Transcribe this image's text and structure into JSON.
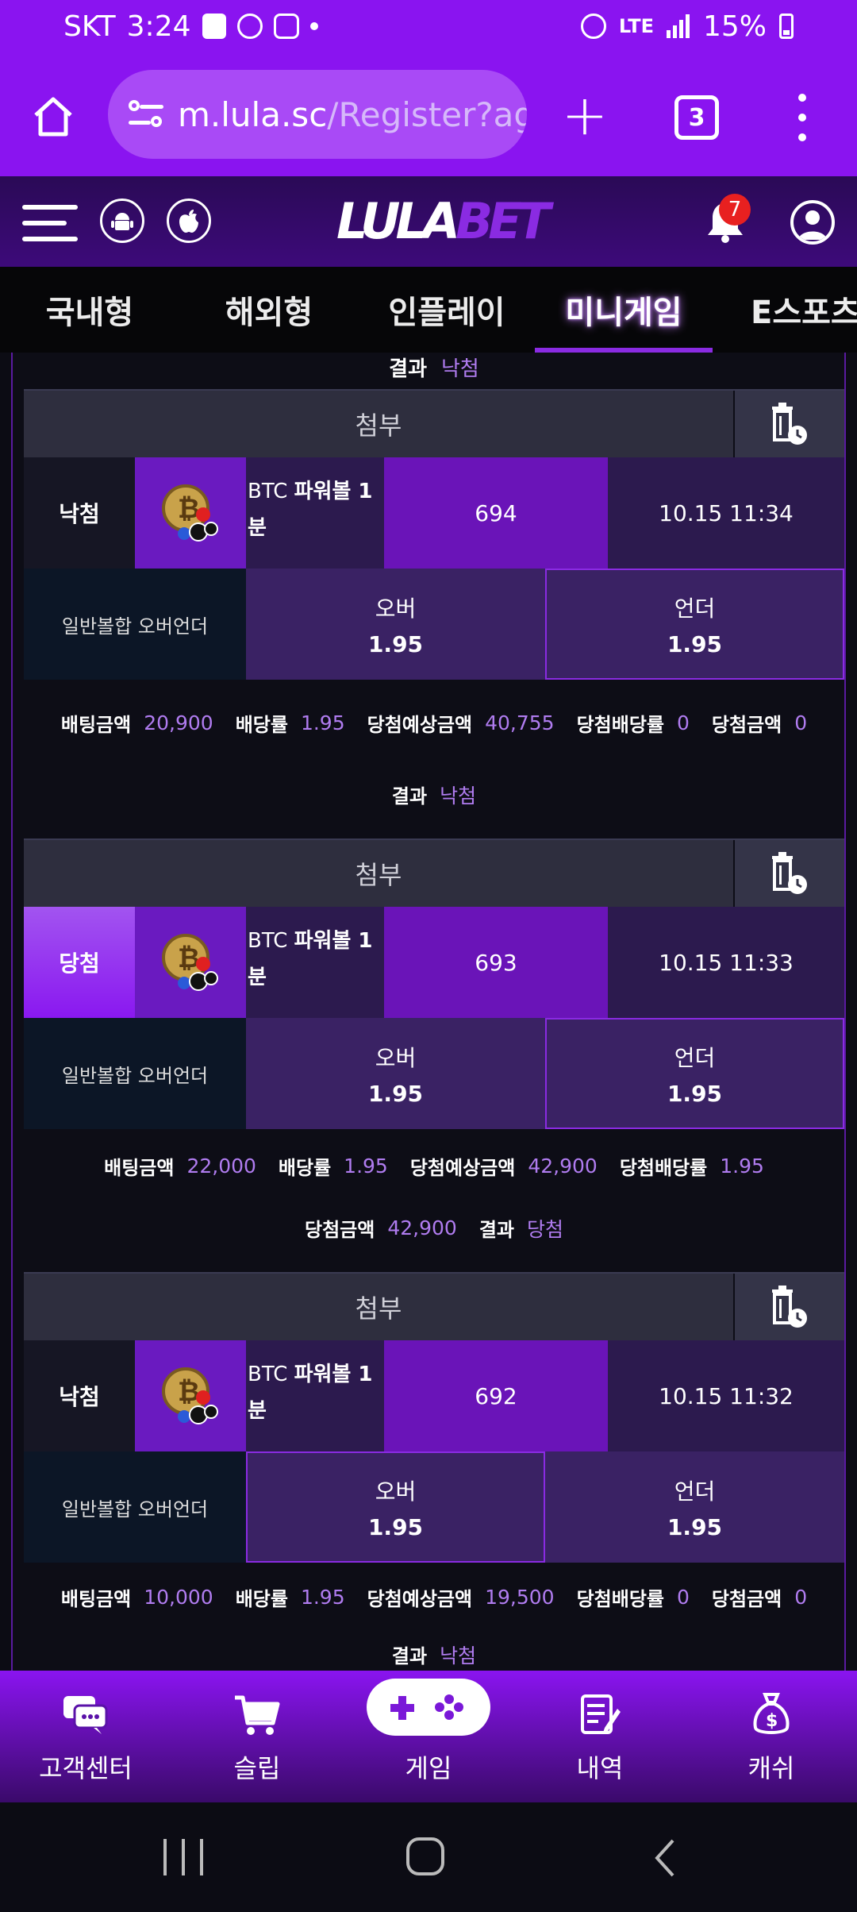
{
  "status_bar": {
    "carrier": "SKT",
    "time": "3:24",
    "network": "LTE",
    "battery": "15%"
  },
  "browser": {
    "url_host": "m.lula.sc",
    "url_path": "/Register?ag",
    "tab_count": "3"
  },
  "site": {
    "logo_part1": "LULA",
    "logo_part2": "BET",
    "notification_count": "7"
  },
  "category_tabs": [
    {
      "label": "국내형"
    },
    {
      "label": "해외형"
    },
    {
      "label": "인플레이"
    },
    {
      "label": "미니게임",
      "active": true
    },
    {
      "label": "E스포츠"
    }
  ],
  "top_result": {
    "label": "결과",
    "value": "낙첨"
  },
  "bets": [
    {
      "attach_label": "첨부",
      "status": "낙첨",
      "game_name": "BTC 파워볼 1분",
      "round": "694",
      "time": "10.15 11:34",
      "market": "일반볼합 오버언더",
      "option1_name": "오버",
      "option1_odds": "1.95",
      "option2_name": "언더",
      "option2_odds": "1.95",
      "bet_amount_label": "배팅금액",
      "bet_amount": "20,900",
      "odds_label": "배당률",
      "odds": "1.95",
      "expected_label": "당첨예상금액",
      "expected": "40,755",
      "win_odds_label": "당첨배당률",
      "win_odds": "0",
      "win_amount_label": "당첨금액",
      "win_amount": "0",
      "result_label": "결과",
      "result": "낙첨"
    },
    {
      "attach_label": "첨부",
      "status": "당첨",
      "game_name": "BTC 파워볼 1분",
      "round": "693",
      "time": "10.15 11:33",
      "market": "일반볼합 오버언더",
      "option1_name": "오버",
      "option1_odds": "1.95",
      "option2_name": "언더",
      "option2_odds": "1.95",
      "bet_amount_label": "배팅금액",
      "bet_amount": "22,000",
      "odds_label": "배당률",
      "odds": "1.95",
      "expected_label": "당첨예상금액",
      "expected": "42,900",
      "win_odds_label": "당첨배당률",
      "win_odds": "1.95",
      "win_amount_label": "당첨금액",
      "win_amount": "42,900",
      "result_label": "결과",
      "result": "당첨"
    },
    {
      "attach_label": "첨부",
      "status": "낙첨",
      "game_name": "BTC 파워볼 1분",
      "round": "692",
      "time": "10.15 11:32",
      "market": "일반볼합 오버언더",
      "option1_name": "오버",
      "option1_odds": "1.95",
      "option2_name": "언더",
      "option2_odds": "1.95",
      "bet_amount_label": "배팅금액",
      "bet_amount": "10,000",
      "odds_label": "배당률",
      "odds": "1.95",
      "expected_label": "당첨예상금액",
      "expected": "19,500",
      "win_odds_label": "당첨배당률",
      "win_odds": "0",
      "win_amount_label": "당첨금액",
      "win_amount": "0",
      "result_label": "결과",
      "result": "낙첨"
    }
  ],
  "bottom_nav": [
    {
      "label": "고객센터",
      "icon": "chat-icon"
    },
    {
      "label": "슬립",
      "icon": "cart-icon"
    },
    {
      "label": "게임",
      "icon": "gamepad-icon"
    },
    {
      "label": "내역",
      "icon": "history-icon"
    },
    {
      "label": "캐쉬",
      "icon": "money-bag-icon"
    }
  ],
  "colors": {
    "primary": "#8a14f0",
    "accent_text": "#b07cf0",
    "win": "#9a3cf0"
  }
}
